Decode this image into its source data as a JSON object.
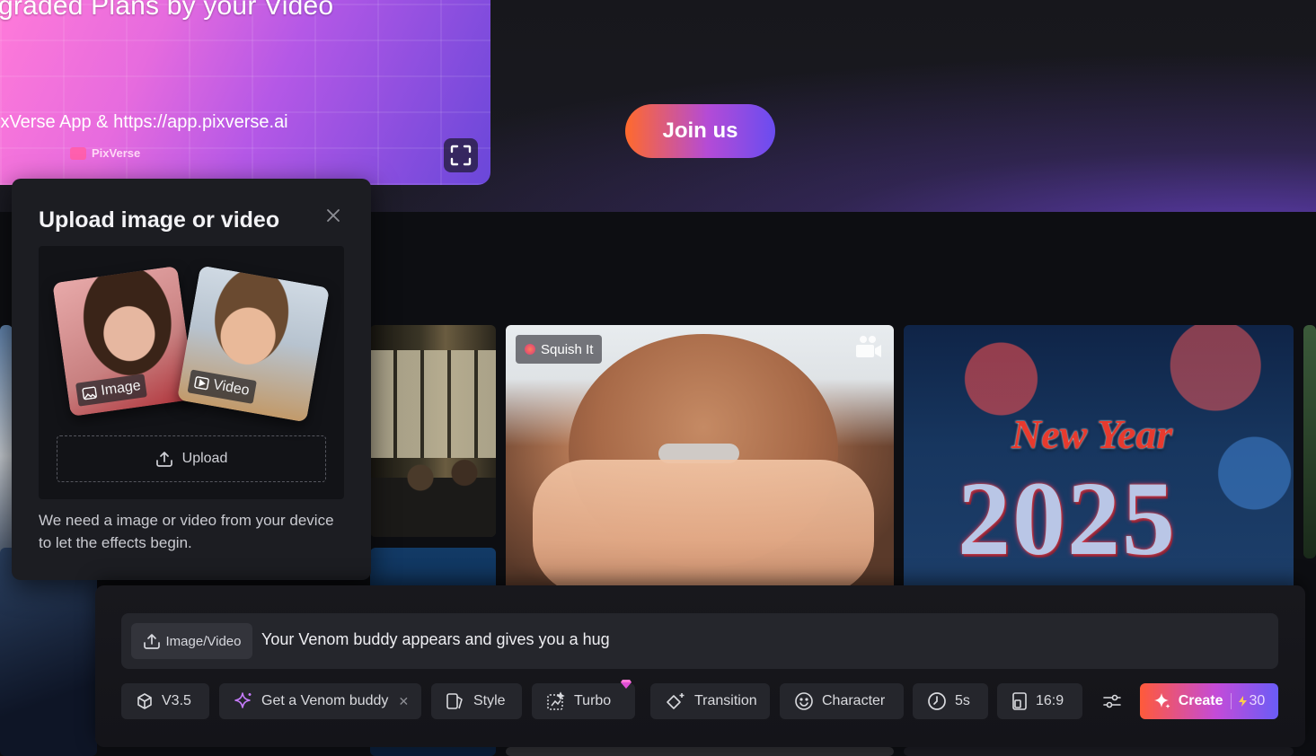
{
  "banner": {
    "promo_title": "graded Plans by your Video",
    "promo_url": "ixVerse App & https://app.pixverse.ai",
    "promo_brand": "PixVerse",
    "join_label": "Join us"
  },
  "gallery": {
    "squish_badge": "Squish It",
    "newyear_title": "New Year",
    "newyear_year": "2025"
  },
  "upload_popover": {
    "title": "Upload image or video",
    "image_tag": "Image",
    "video_tag": "Video",
    "upload_label": "Upload",
    "description": "We need a image or video from your device to let the effects begin."
  },
  "composer": {
    "image_video_label": "Image/Video",
    "prompt": "Your Venom buddy appears and gives you a hug",
    "tools": {
      "model": "V3.5",
      "effect": "Get a Venom buddy",
      "style": "Style",
      "turbo": "Turbo",
      "transition": "Transition",
      "character": "Character",
      "duration": "5s",
      "ratio": "16:9"
    },
    "create_label": "Create",
    "credits": "30"
  },
  "colors": {
    "accent_start": "#ff5a3a",
    "accent_end": "#6a5cf6",
    "panel": "#1c1d22",
    "background": "#0d0e12"
  }
}
